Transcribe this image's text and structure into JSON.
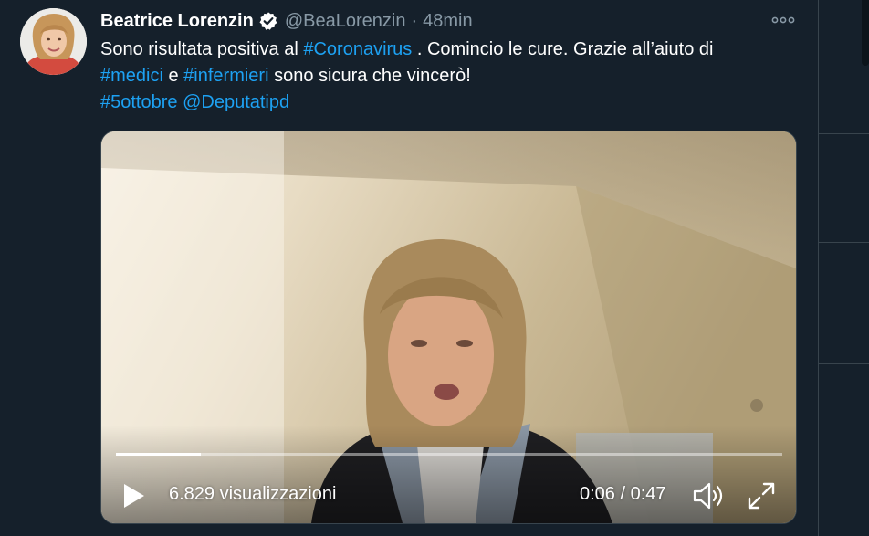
{
  "tweet": {
    "author": {
      "display_name": "Beatrice Lorenzin",
      "handle": "@BeaLorenzin",
      "verified": true,
      "avatar_icon": "profile-photo"
    },
    "separator": "·",
    "timestamp": "48min",
    "text": {
      "line1_part1": "Sono risultata positiva al ",
      "hashtag_coronavirus": "#Coronavirus",
      "line1_part2": " . Comincio le cure. Grazie all’aiuto di ",
      "hashtag_medici": "#medici",
      "conj_e": " e ",
      "hashtag_infermieri": "#infermieri",
      "line2_part2": " sono sicura che vincerò!",
      "hashtag_5ottobre": "#5ottobre",
      "mention_deputatipd": "@Deputatipd"
    },
    "more_icon": "ellipsis-icon"
  },
  "video": {
    "views_label": "6.829 visualizzazioni",
    "current_time": "0:06",
    "time_separator": " / ",
    "duration": "0:47",
    "progress_fraction": 0.128,
    "icons": {
      "play": "play-icon",
      "volume": "volume-icon",
      "fullscreen": "fullscreen-icon"
    }
  },
  "colors": {
    "background": "#15202b",
    "link": "#1da1f2",
    "secondary_text": "#8899a6",
    "border": "#38444d",
    "verified_badge": "#ffffff"
  }
}
